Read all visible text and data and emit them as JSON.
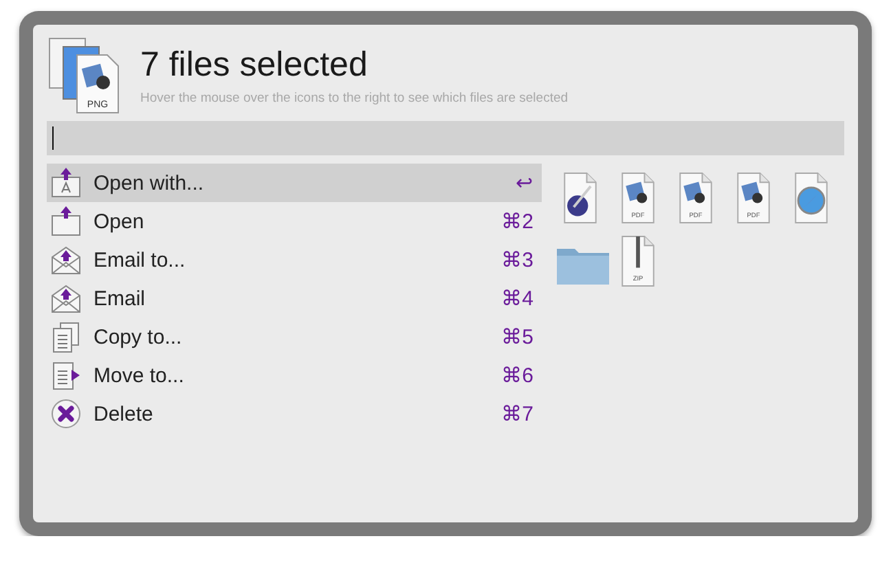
{
  "header": {
    "icon_label": "PNG",
    "title": "7 files selected",
    "subtitle": "Hover the mouse over the icons to the right to see which files are selected"
  },
  "actions": [
    {
      "kind": "open-with",
      "label": "Open with...",
      "shortcut": "↩",
      "selected": true
    },
    {
      "kind": "open",
      "label": "Open",
      "shortcut": "⌘2",
      "selected": false
    },
    {
      "kind": "email",
      "label": "Email to...",
      "shortcut": "⌘3",
      "selected": false
    },
    {
      "kind": "email",
      "label": "Email",
      "shortcut": "⌘4",
      "selected": false
    },
    {
      "kind": "copy",
      "label": "Copy to...",
      "shortcut": "⌘5",
      "selected": false
    },
    {
      "kind": "move",
      "label": "Move to...",
      "shortcut": "⌘6",
      "selected": false
    },
    {
      "kind": "delete",
      "label": "Delete",
      "shortcut": "⌘7",
      "selected": false
    }
  ],
  "files": [
    {
      "kind": "ink"
    },
    {
      "kind": "doc",
      "label": "PDF"
    },
    {
      "kind": "doc",
      "label": "PDF"
    },
    {
      "kind": "doc",
      "label": "PDF"
    },
    {
      "kind": "compass"
    },
    {
      "kind": "folder"
    },
    {
      "kind": "zip",
      "label": "ZIP"
    }
  ]
}
